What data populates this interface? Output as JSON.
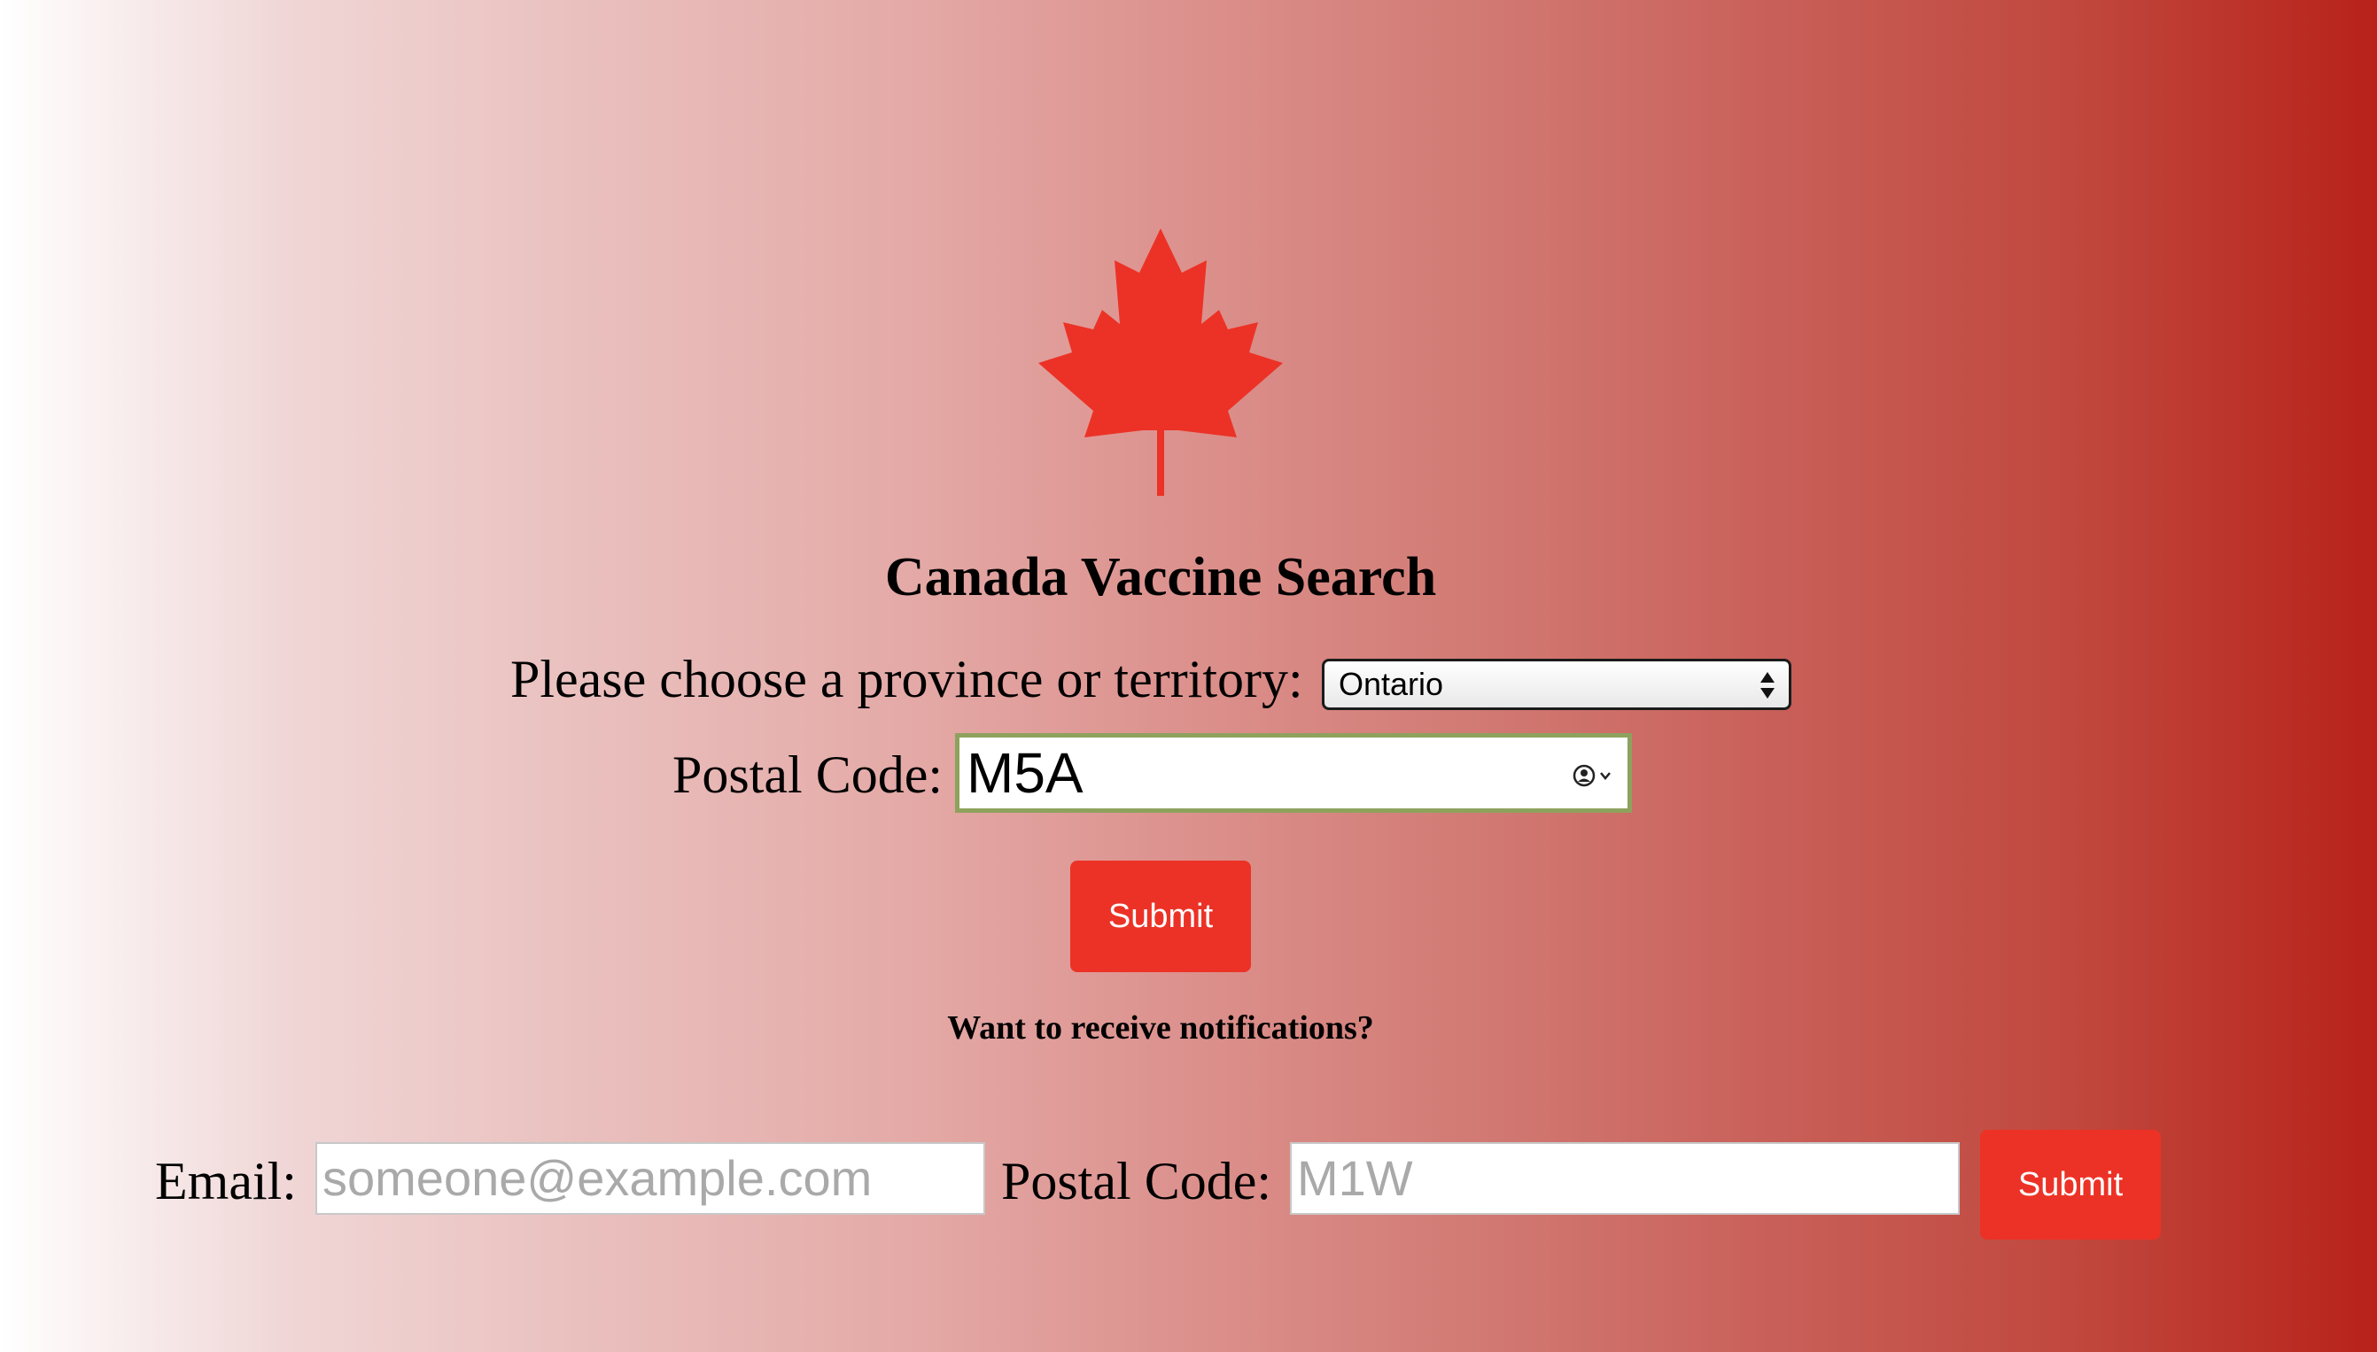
{
  "page": {
    "title": "Canada Vaccine Search",
    "logo_icon": "maple-leaf-icon",
    "accent_color": "#ec3226"
  },
  "search_form": {
    "province_label": "Please choose a province or territory:",
    "province_selected": "Ontario",
    "postal_label": "Postal Code:",
    "postal_value": "M5A",
    "autofill_icon": "contact-autofill-icon",
    "submit_label": "Submit"
  },
  "notifications": {
    "heading": "Want to receive notifications?",
    "email_label": "Email:",
    "email_placeholder": "someone@example.com",
    "postal_label": "Postal Code:",
    "postal_placeholder": "M1W",
    "submit_label": "Submit"
  }
}
